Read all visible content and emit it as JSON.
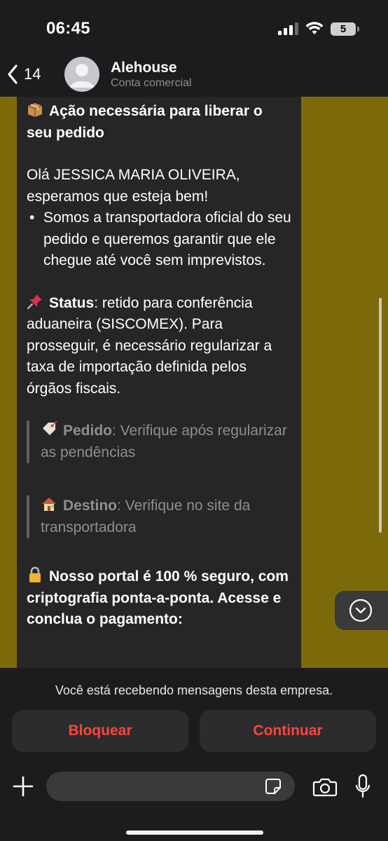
{
  "status_bar": {
    "time": "06:45",
    "battery": "5"
  },
  "header": {
    "back_count": "14",
    "title": "Alehouse",
    "subtitle": "Conta comercial"
  },
  "message": {
    "heading": "Ação necessária para liberar o seu pedido",
    "greeting": "Olá JESSICA MARIA OLIVEIRA, esperamos que esteja bem!",
    "bullet": "Somos a transportadora oficial do seu pedido e queremos garantir que ele chegue até você sem imprevistos.",
    "status_label": "Status",
    "status_text": ": retido para conferência aduaneira (SISCOMEX). Para prosseguir, é necessário regularizar a taxa de importação definida pelos órgãos fiscais.",
    "pedido_label": "Pedido",
    "pedido_text": ": Verifique após regularizar as pendências",
    "destino_label": "Destino",
    "destino_text": ": Verifique no site da transportadora",
    "secure_text": "Nosso portal é 100 % seguro, com criptografia ponta-a-ponta. Acesse e conclua o pagamento:"
  },
  "bottom": {
    "notice": "Você está recebendo mensagens desta empresa.",
    "block_label": "Bloquear",
    "continue_label": "Continuar",
    "input_placeholder": ""
  },
  "icons": {
    "back": "chevron-left-icon",
    "heading": "package-icon",
    "status": "pushpin-icon",
    "pedido": "tag-icon",
    "destino": "house-icon",
    "secure": "lock-icon",
    "jump": "chevron-down-circle-icon",
    "plus": "plus-icon",
    "sticker": "sticker-icon",
    "camera": "camera-icon",
    "mic": "microphone-icon"
  },
  "colors": {
    "wallpaper": "#7d6b0b",
    "bubble": "#262626",
    "destructive": "#ff453a"
  }
}
